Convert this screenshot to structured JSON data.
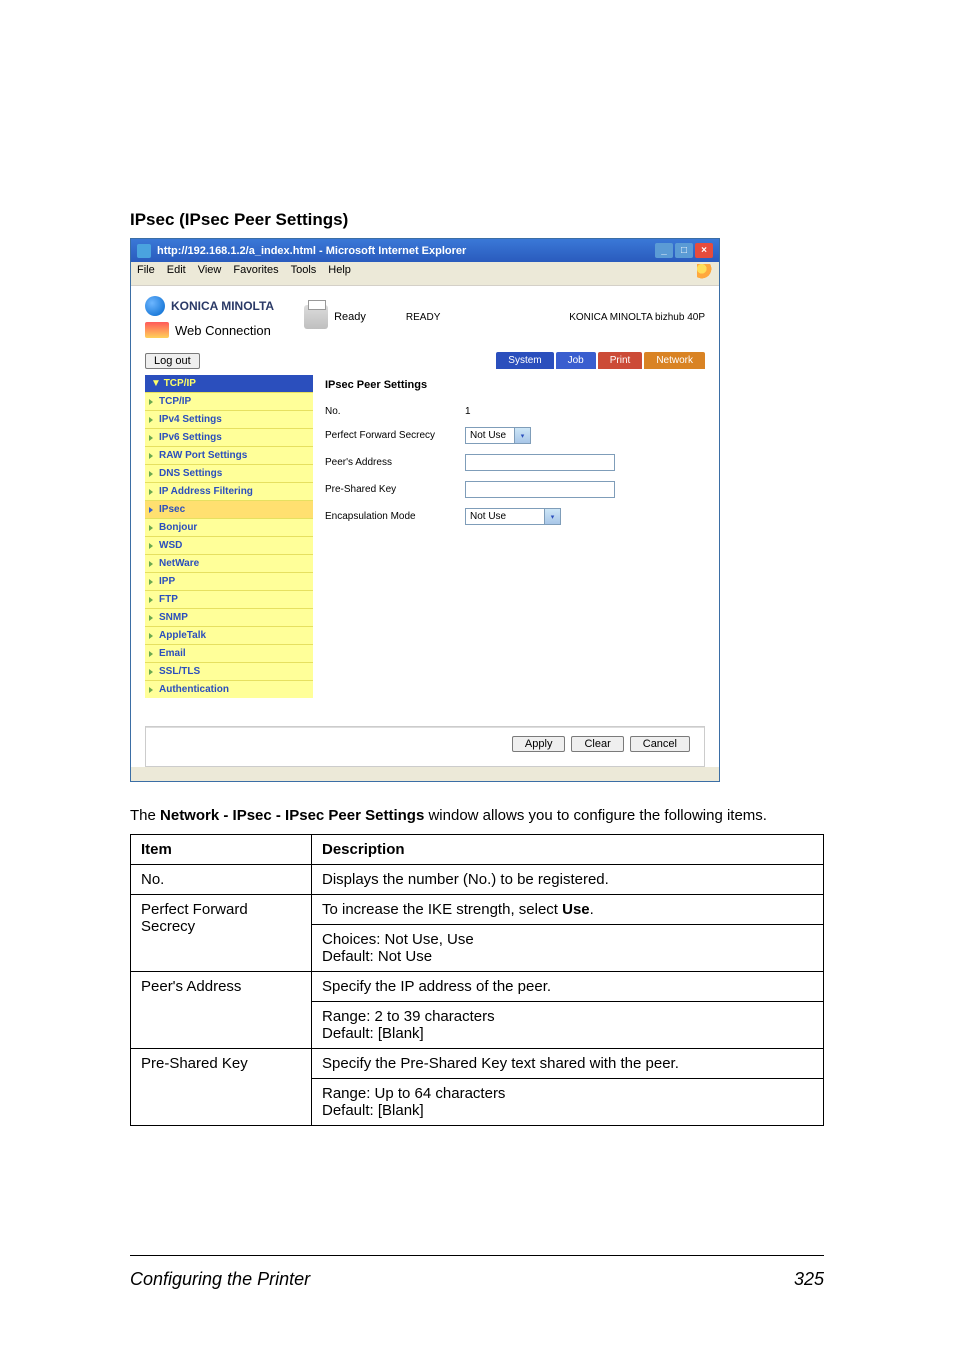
{
  "page_heading": "IPsec (IPsec Peer Settings)",
  "browser": {
    "title": "http://192.168.1.2/a_index.html - Microsoft Internet Explorer",
    "menu": {
      "file": "File",
      "edit": "Edit",
      "view": "View",
      "favorites": "Favorites",
      "tools": "Tools",
      "help": "Help"
    }
  },
  "header": {
    "km": "KONICA MINOLTA",
    "web_connection": "Web Connection",
    "ready_label": "Ready",
    "ready_status": "READY",
    "device": "KONICA MINOLTA bizhub 40P",
    "logout": "Log out"
  },
  "tabs": {
    "system": "System",
    "job": "Job",
    "print": "Print",
    "network": "Network"
  },
  "sidebar": {
    "head": "TCP/IP",
    "items": [
      "TCP/IP",
      "IPv4 Settings",
      "IPv6 Settings",
      "RAW Port Settings",
      "DNS Settings",
      "IP Address Filtering",
      "IPsec",
      "Bonjour",
      "WSD",
      "NetWare",
      "IPP",
      "FTP",
      "SNMP",
      "AppleTalk",
      "Email",
      "SSL/TLS",
      "Authentication"
    ],
    "active_index": 6
  },
  "content": {
    "title": "IPsec Peer Settings",
    "rows": {
      "no": {
        "label": "No.",
        "value": "1"
      },
      "pfs": {
        "label": "Perfect Forward Secrecy",
        "select": "Not Use"
      },
      "peer": {
        "label": "Peer's Address",
        "value": ""
      },
      "psk": {
        "label": "Pre-Shared Key",
        "value": ""
      },
      "encap": {
        "label": "Encapsulation Mode",
        "select": "Not Use"
      }
    }
  },
  "buttons": {
    "apply": "Apply",
    "clear": "Clear",
    "cancel": "Cancel"
  },
  "description": {
    "para_prefix": "The ",
    "para_bold": "Network - IPsec - IPsec Peer Settings",
    "para_suffix": " window allows you to configure the following items.",
    "th_item": "Item",
    "th_desc": "Description",
    "rows": [
      {
        "item": "No.",
        "desc": "Displays the number (No.) to be registered."
      },
      {
        "item": "Perfect Forward Secrecy",
        "desc_line1": "To increase the IKE strength, select ",
        "desc_bold": "Use",
        "desc_suffix": ".",
        "desc_line2": "Choices: Not Use, Use",
        "desc_line3": "Default:   Not Use"
      },
      {
        "item": "Peer's Address",
        "desc_line1": "Specify the IP address of the peer.",
        "desc_line2": "Range:   2 to 39 characters",
        "desc_line3": "Default:   [Blank]"
      },
      {
        "item": "Pre-Shared Key",
        "desc_line1": "Specify the Pre-Shared Key text shared with the peer.",
        "desc_line2": "Range:   Up to 64 characters",
        "desc_line3": "Default:   [Blank]"
      }
    ]
  },
  "footer": {
    "left": "Configuring the Printer",
    "right": "325"
  }
}
